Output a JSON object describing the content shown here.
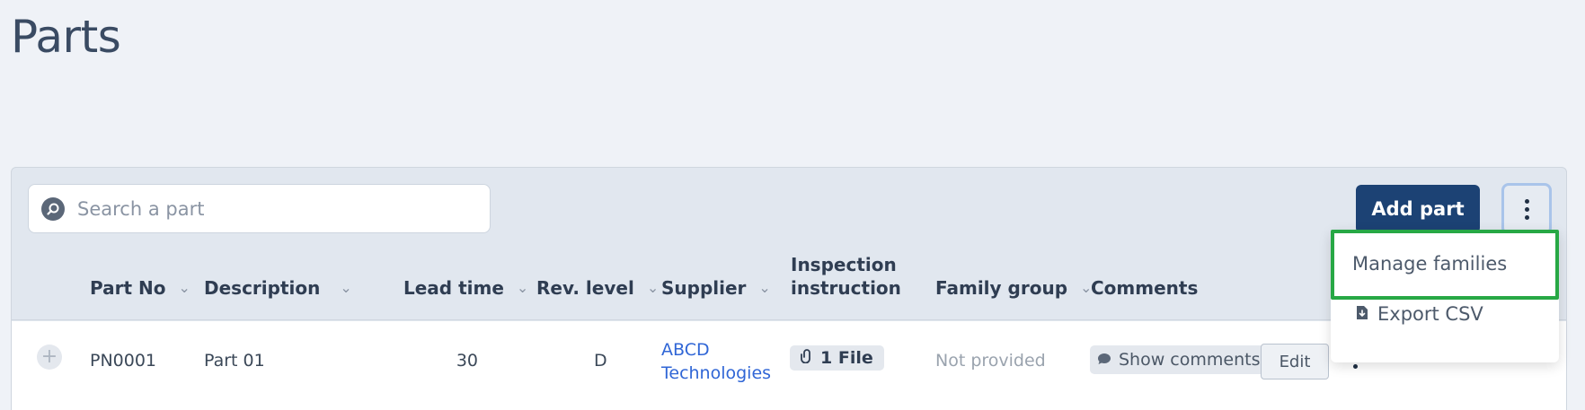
{
  "page": {
    "title": "Parts"
  },
  "toolbar": {
    "search_placeholder": "Search a part",
    "add_label": "Add part"
  },
  "table": {
    "columns": [
      {
        "label": "Part No"
      },
      {
        "label": "Description"
      },
      {
        "label": "Lead time"
      },
      {
        "label": "Rev. level"
      },
      {
        "label": "Supplier"
      },
      {
        "label_line1": "Inspection",
        "label_line2": "instruction"
      },
      {
        "label": "Family group"
      },
      {
        "label": "Comments"
      }
    ],
    "rows": [
      {
        "part_no": "PN0001",
        "description": "Part 01",
        "lead_time": "30",
        "rev_level": "D",
        "supplier_line1": "ABCD",
        "supplier_line2": "Technologies",
        "inspection": "1 File",
        "family_group": "Not provided",
        "comments": "Show comments",
        "edit": "Edit"
      }
    ]
  },
  "menu": {
    "items": [
      {
        "label": "Manage families"
      },
      {
        "label": "Export CSV"
      }
    ]
  },
  "colors": {
    "primary": "#1c4274",
    "link": "#3066d6",
    "highlight": "#27a845"
  },
  "icons": [
    "search-icon",
    "chevron-down-icon",
    "kebab-icon",
    "paperclip-icon",
    "comment-icon",
    "export-icon",
    "plus-icon"
  ]
}
